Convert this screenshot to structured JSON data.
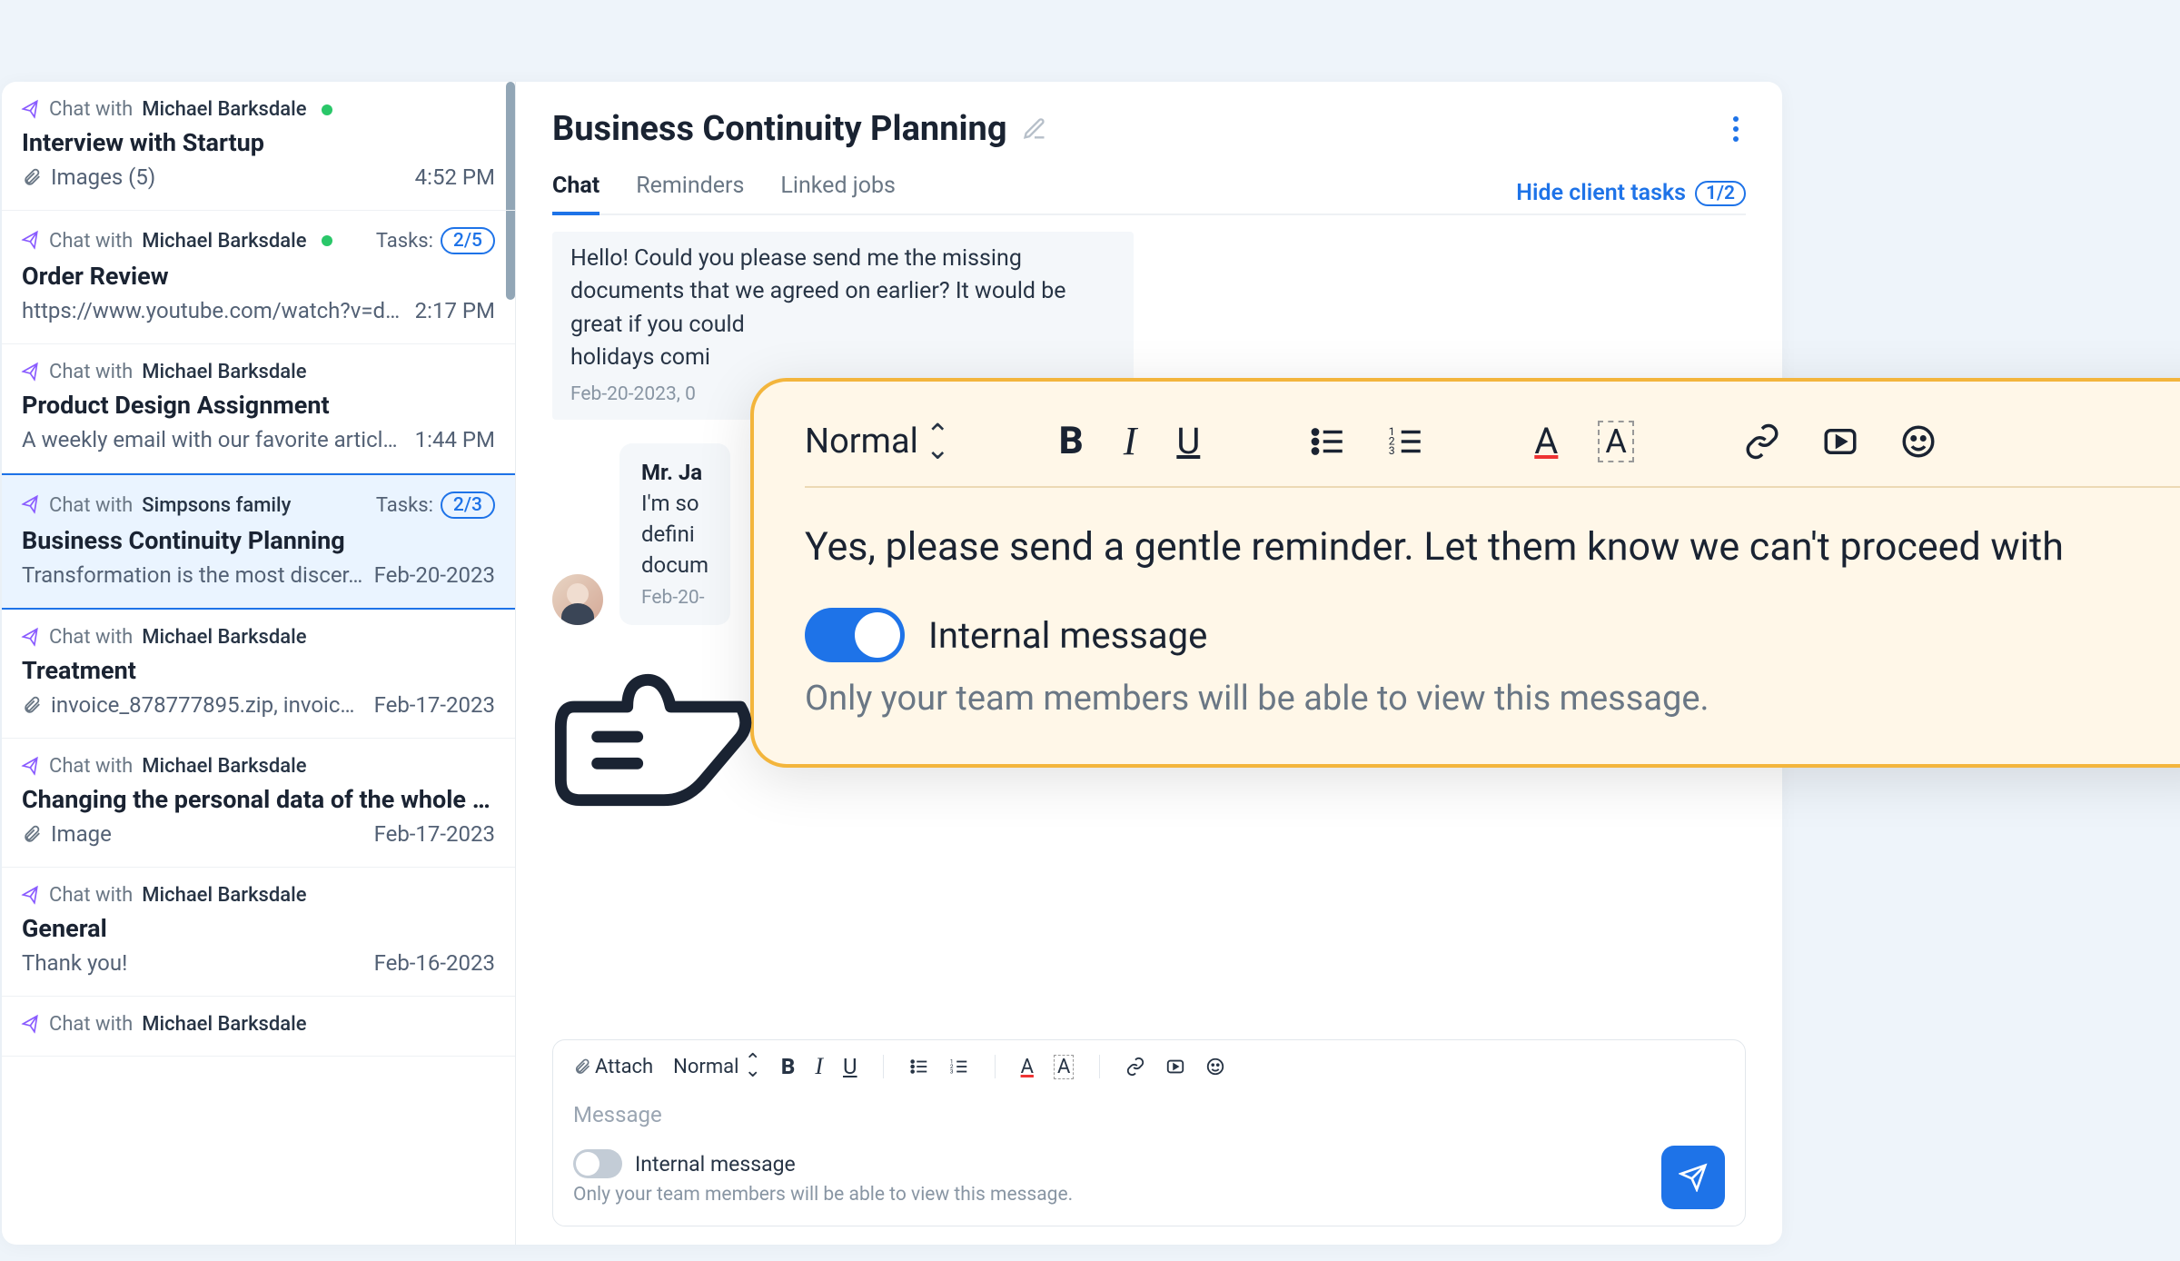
{
  "sidebar": {
    "items": [
      {
        "chatWith": "Chat with",
        "name": "Michael Barksdale",
        "online": true,
        "title": "Interview with Startup",
        "preview": "Images (5)",
        "hasAttach": true,
        "time": "4:52 PM"
      },
      {
        "chatWith": "Chat with",
        "name": "Michael Barksdale",
        "online": true,
        "title": "Order Review",
        "preview": "https://www.youtube.com/watch?v=d…",
        "time": "2:17 PM",
        "tasks": "2/5",
        "tasksLabel": "Tasks:"
      },
      {
        "chatWith": "Chat with",
        "name": "Michael Barksdale",
        "title": "Product Design Assignment",
        "preview": "A weekly email with our favorite articl…",
        "time": "1:44 PM"
      },
      {
        "chatWith": "Chat with",
        "name": "Simpsons family",
        "title": "Business Continuity Planning",
        "preview": "Transformation is the most discer…",
        "time": "Feb-20-2023",
        "tasks": "2/3",
        "tasksLabel": "Tasks:",
        "selected": true
      },
      {
        "chatWith": "Chat with",
        "name": "Michael Barksdale",
        "title": "Treatment",
        "preview": "invoice_878777895.zip, invoic…",
        "hasAttach": true,
        "time": "Feb-17-2023"
      },
      {
        "chatWith": "Chat with",
        "name": "Michael Barksdale",
        "title": "Changing the personal data of the whole fam…",
        "preview": "Image",
        "hasAttach": true,
        "time": "Feb-17-2023"
      },
      {
        "chatWith": "Chat with",
        "name": "Michael Barksdale",
        "title": "General",
        "preview": "Thank you!",
        "time": "Feb-16-2023"
      },
      {
        "chatWith": "Chat with",
        "name": "Michael Barksdale"
      }
    ]
  },
  "header": {
    "title": "Business Continuity Planning"
  },
  "tabs": {
    "items": [
      "Chat",
      "Reminders",
      "Linked jobs"
    ],
    "hideLabel": "Hide client tasks",
    "hideBadge": "1/2"
  },
  "messages": {
    "first": {
      "text": "Hello! Could you please send me the missing documents that we agreed on earlier? It would be great if you could",
      "line3": "holidays comi",
      "ts": "Feb-20-2023, 0"
    },
    "reply": {
      "name": "Mr. Ja",
      "l1": "I'm so",
      "l2": "defini",
      "l3": "docum",
      "ts": "Feb-20-"
    }
  },
  "composer": {
    "attach": "Attach",
    "normal": "Normal",
    "placeholder": "Message",
    "internalLabel": "Internal message",
    "internalHelp": "Only your team members will be able to view this message."
  },
  "callout": {
    "normal": "Normal",
    "text": "Yes, please send a gentle reminder. Let them know we can't proceed with",
    "internalLabel": "Internal message",
    "internalHelp": "Only your team members will be able to view this message."
  }
}
